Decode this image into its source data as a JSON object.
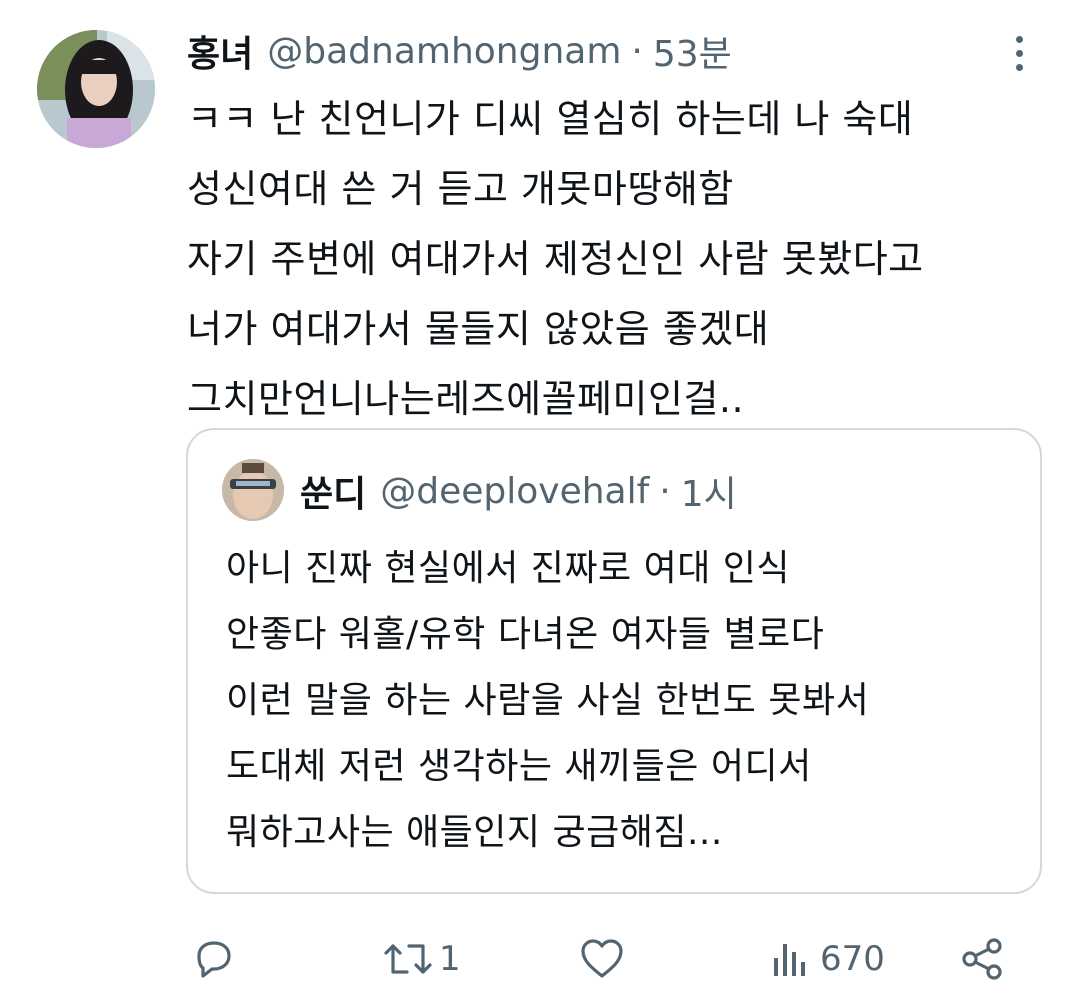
{
  "tweet": {
    "author_name": "홍녀",
    "author_handle": "@badnamhongnam",
    "separator": "·",
    "time": "53분",
    "body_lines": [
      "ㅋㅋ 난 친언니가 디씨 열심히 하는데 나 숙대",
      "성신여대 쓴 거 듣고 개못마땅해함",
      "자기 주변에 여대가서 제정신인 사람 못봤다고",
      "너가 여대가서 물들지 않았음 좋겠대",
      "그치만언니나는레즈에꼴페미인걸.."
    ],
    "avatar_icon": "profile-photo-avatar",
    "more_icon": "more-options-icon"
  },
  "quoted": {
    "author_name": "쑨디",
    "author_handle": "@deeplovehalf",
    "separator": "·",
    "time": "1시",
    "body_lines": [
      "아니 진짜 현실에서 진짜로 여대 인식",
      "안좋다 워홀/유학 다녀온 여자들 별로다",
      "이런 말을 하는 사람을 사실 한번도 못봐서",
      "도대체 저런 생각하는 새끼들은 어디서",
      "뭐하고사는 애들인지 궁금해짐..."
    ]
  },
  "actions": {
    "reply_icon": "reply-icon",
    "retweet_icon": "retweet-icon",
    "retweet_count": "1",
    "like_icon": "heart-icon",
    "views_icon": "views-icon",
    "views_count": "670",
    "share_icon": "share-icon"
  },
  "colors": {
    "text": "#0f1419",
    "secondary": "#536471",
    "border": "#cfd9de"
  }
}
